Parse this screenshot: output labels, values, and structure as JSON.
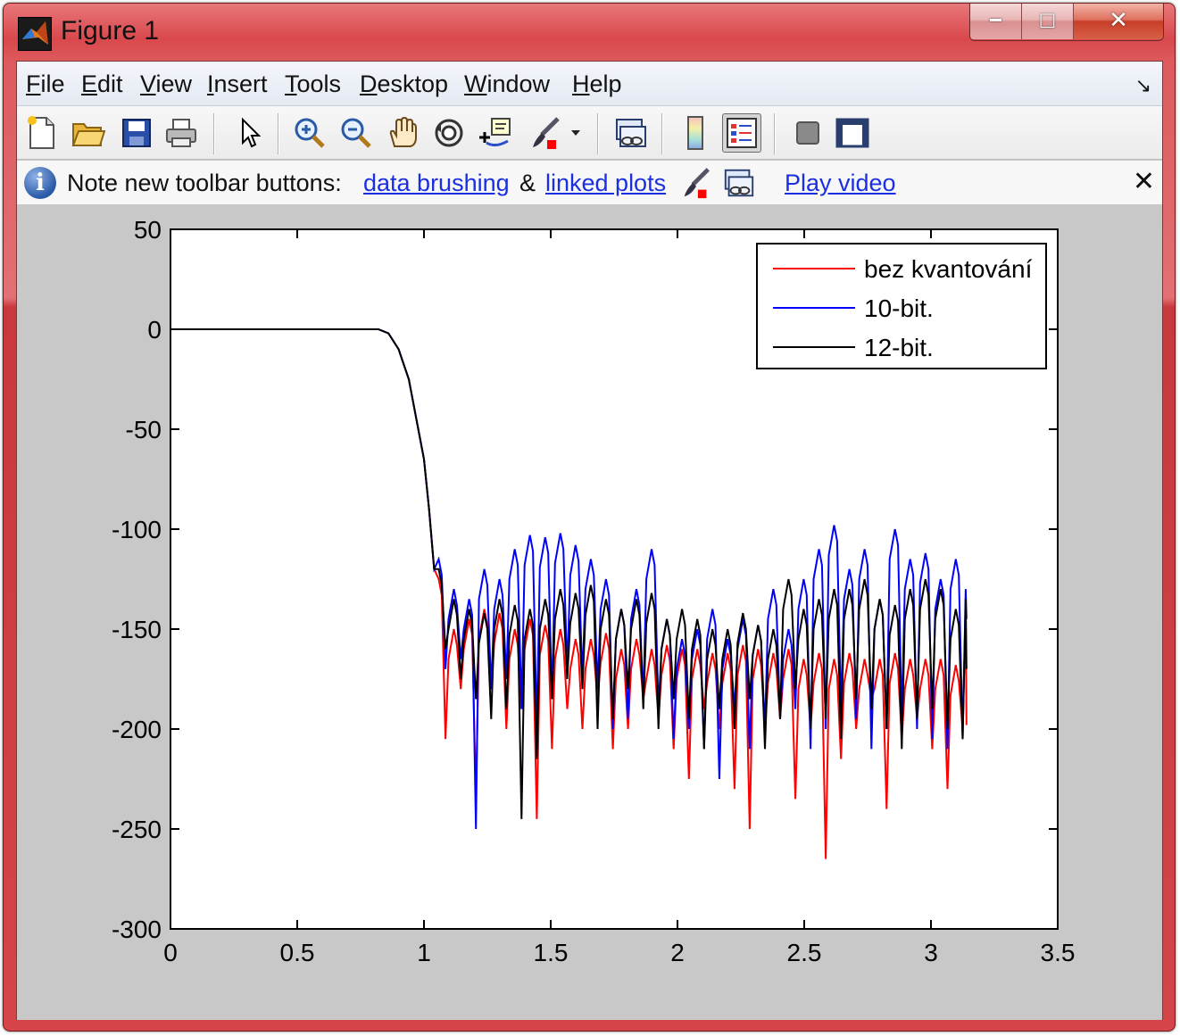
{
  "window": {
    "title": "Figure 1",
    "controls": {
      "minimize": "−",
      "maximize": "□",
      "close": "✕"
    }
  },
  "menubar": {
    "items": [
      {
        "label": "File",
        "ul": "F",
        "rest": "ile"
      },
      {
        "label": "Edit",
        "ul": "E",
        "rest": "dit"
      },
      {
        "label": "View",
        "ul": "V",
        "rest": "iew"
      },
      {
        "label": "Insert",
        "ul": "I",
        "rest": "nsert"
      },
      {
        "label": "Tools",
        "ul": "T",
        "rest": "ools"
      },
      {
        "label": "Desktop",
        "ul": "D",
        "rest": "esktop"
      },
      {
        "label": "Window",
        "ul": "W",
        "rest": "indow"
      },
      {
        "label": "Help",
        "ul": "H",
        "rest": "elp"
      }
    ],
    "dock_arrow": "↘"
  },
  "toolbar": {
    "buttons": [
      "new-figure",
      "open-file",
      "save-figure",
      "print-figure",
      "edit-plot",
      "zoom-in",
      "zoom-out",
      "pan",
      "rotate-3d",
      "data-cursor",
      "brush",
      "link-plot",
      "insert-colorbar",
      "insert-legend",
      "hide-plot-tools",
      "show-plot-tools"
    ],
    "pressed": "insert-legend"
  },
  "infobar": {
    "note": "Note new toolbar buttons:",
    "link_brushing": "data brushing",
    "amp": "&",
    "link_linked": "linked plots",
    "link_video": "Play video",
    "close": "✕"
  },
  "chart_data": {
    "type": "line",
    "title": "",
    "xlabel": "",
    "ylabel": "",
    "xlim": [
      0,
      3.5
    ],
    "ylim": [
      -300,
      50
    ],
    "xticks": [
      "0",
      "0.5",
      "1",
      "1.5",
      "2",
      "2.5",
      "3",
      "3.5"
    ],
    "xtick_values": [
      0,
      0.5,
      1,
      1.5,
      2,
      2.5,
      3,
      3.5
    ],
    "yticks": [
      "50",
      "0",
      "-50",
      "-100",
      "-150",
      "-200",
      "-250",
      "-300"
    ],
    "ytick_values": [
      50,
      0,
      -50,
      -100,
      -150,
      -200,
      -250,
      -300
    ],
    "grid": false,
    "legend_position": "top-right",
    "passband": {
      "x_end": 0.82,
      "y": 0
    },
    "transition": [
      [
        0.82,
        0
      ],
      [
        0.86,
        -2
      ],
      [
        0.9,
        -10
      ],
      [
        0.94,
        -25
      ],
      [
        0.97,
        -45
      ],
      [
        1.0,
        -65
      ],
      [
        1.02,
        -90
      ],
      [
        1.04,
        -120
      ]
    ],
    "stopband_x_end": 3.14,
    "series": [
      {
        "name": "bez kvantování",
        "color": "#ff0000",
        "peaks": [
          -125,
          -150,
          -145,
          -140,
          -142,
          -150,
          -145,
          -148,
          -150,
          -155,
          -155,
          -152,
          -160,
          -155,
          -160,
          -158,
          -160,
          -160,
          -162,
          -162,
          -158,
          -160,
          -162,
          -160,
          -165,
          -162,
          -165,
          -162,
          -165,
          -165,
          -162,
          -165,
          -165,
          -165,
          -168
        ],
        "nulls": [
          -205,
          -180,
          -235,
          -180,
          -200,
          -190,
          -245,
          -210,
          -190,
          -200,
          -185,
          -210,
          -200,
          -185,
          -195,
          -210,
          -225,
          -190,
          -200,
          -230,
          -250,
          -200,
          -195,
          -235,
          -200,
          -265,
          -215,
          -200,
          -185,
          -240,
          -205,
          -195,
          -210,
          -230,
          -200
        ]
      },
      {
        "name": "10-bit.",
        "color": "#0000ff",
        "peaks": [
          -115,
          -130,
          -135,
          -120,
          -125,
          -110,
          -103,
          -104,
          -102,
          -108,
          -115,
          -125,
          -140,
          -130,
          -110,
          -145,
          -155,
          -150,
          -140,
          -155,
          -145,
          -148,
          -130,
          -150,
          -125,
          -110,
          -98,
          -120,
          -110,
          -135,
          -100,
          -115,
          -112,
          -125,
          -115
        ],
        "nulls": [
          -170,
          -165,
          -250,
          -180,
          -175,
          -190,
          -200,
          -185,
          -170,
          -175,
          -180,
          -200,
          -195,
          -185,
          -190,
          -205,
          -200,
          -210,
          -225,
          -190,
          -210,
          -200,
          -195,
          -190,
          -210,
          -200,
          -190,
          -195,
          -210,
          -200,
          -195,
          -200,
          -205,
          -210,
          -205
        ]
      },
      {
        "name": "12-bit.",
        "color": "#000000",
        "peaks": [
          -120,
          -135,
          -140,
          -142,
          -135,
          -138,
          -140,
          -135,
          -130,
          -132,
          -128,
          -135,
          -140,
          -135,
          -132,
          -145,
          -140,
          -145,
          -150,
          -150,
          -142,
          -148,
          -150,
          -125,
          -140,
          -135,
          -130,
          -130,
          -125,
          -135,
          -138,
          -130,
          -125,
          -130,
          -140
        ],
        "nulls": [
          -160,
          -175,
          -185,
          -195,
          -190,
          -245,
          -215,
          -185,
          -175,
          -180,
          -200,
          -195,
          -180,
          -190,
          -200,
          -185,
          -195,
          -210,
          -190,
          -200,
          -185,
          -210,
          -195,
          -180,
          -200,
          -195,
          -205,
          -185,
          -190,
          -200,
          -210,
          -195,
          -190,
          -200,
          -205
        ]
      }
    ]
  }
}
